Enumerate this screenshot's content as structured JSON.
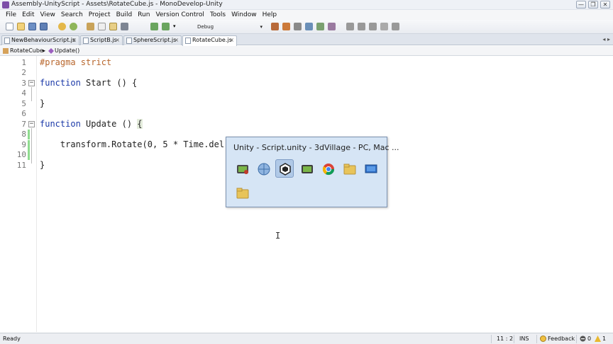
{
  "window": {
    "title": "Assembly-UnityScript - Assets\\RotateCube.js - MonoDevelop-Unity",
    "minimize": "—",
    "maximize": "❐",
    "close": "✕"
  },
  "menu": [
    "File",
    "Edit",
    "View",
    "Search",
    "Project",
    "Build",
    "Run",
    "Version Control",
    "Tools",
    "Window",
    "Help"
  ],
  "toolbar": {
    "configuration": "Debug"
  },
  "tabs": [
    {
      "label": "NewBehaviourScript.js",
      "active": false
    },
    {
      "label": "ScriptB.js",
      "active": false
    },
    {
      "label": "SphereScript.js",
      "active": false
    },
    {
      "label": "RotateCube.js",
      "active": true
    }
  ],
  "breadcrumb": {
    "class": "RotateCube",
    "method": "Update()"
  },
  "editor": {
    "lines": [
      {
        "n": "1",
        "text": "#pragma strict"
      },
      {
        "n": "2",
        "text": ""
      },
      {
        "n": "3",
        "text": "function Start () {"
      },
      {
        "n": "4",
        "text": ""
      },
      {
        "n": "5",
        "text": "}"
      },
      {
        "n": "6",
        "text": ""
      },
      {
        "n": "7",
        "text": "function Update () {"
      },
      {
        "n": "8",
        "text": ""
      },
      {
        "n": "9",
        "text": "    transform.Rotate(0, 5 * Time.del"
      },
      {
        "n": "10",
        "text": ""
      },
      {
        "n": "11",
        "text": "}"
      }
    ]
  },
  "popup": {
    "title": "Unity - Script.unity - 3dVillage - PC, Mac ..."
  },
  "status": {
    "left": "Ready",
    "position": "11 : 2",
    "mode": "INS",
    "feedback": "Feedback",
    "errors": "0",
    "warnings": "1"
  },
  "colors": {
    "keyword": "#1b39a8",
    "preprocessor": "#b8662c",
    "popup_bg": "#d5e4f5",
    "change_marker": "#8fdc8f"
  }
}
